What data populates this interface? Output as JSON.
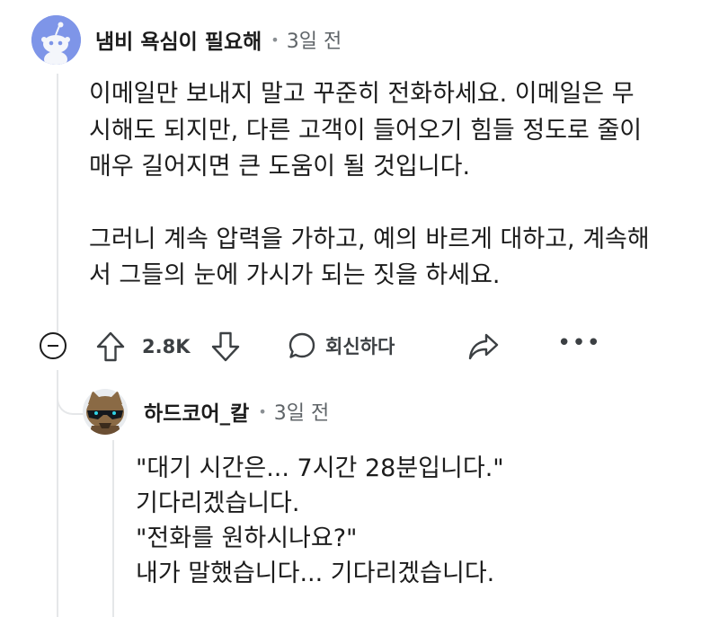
{
  "comment": {
    "author": "냄비 욕심이 필요해",
    "separator": "•",
    "time": "3일 전",
    "paragraphs": [
      [
        "이메일만 보내지 말고 꾸준히 전화하세요. 이메일은 무",
        "시해도 되지만, 다른 고객이 들어오기 힘들 정도로 줄이",
        "매우 길어지면 큰 도움이 될 것입니다."
      ],
      [
        "그러니 계속 압력을 가하고, 예의 바르게 대하고, 계속해",
        "서 그들의 눈에 가시가 되는 짓을 하세요."
      ]
    ],
    "actions": {
      "upvote_count": "2.8K",
      "reply_label": "회신하다",
      "more_label": "•••"
    },
    "colors": {
      "avatar_bg": "#7e95e8",
      "thread_line": "#e5e7e9"
    }
  },
  "reply": {
    "author": "하드코어_칼",
    "separator": "•",
    "time": "3일 전",
    "lines": [
      "\"대기 시간은... 7시간 28분입니다.\"",
      "기다리겠습니다.",
      "\"전화를 원하시나요?\"",
      "내가 말했습니다... 기다리겠습니다."
    ]
  }
}
